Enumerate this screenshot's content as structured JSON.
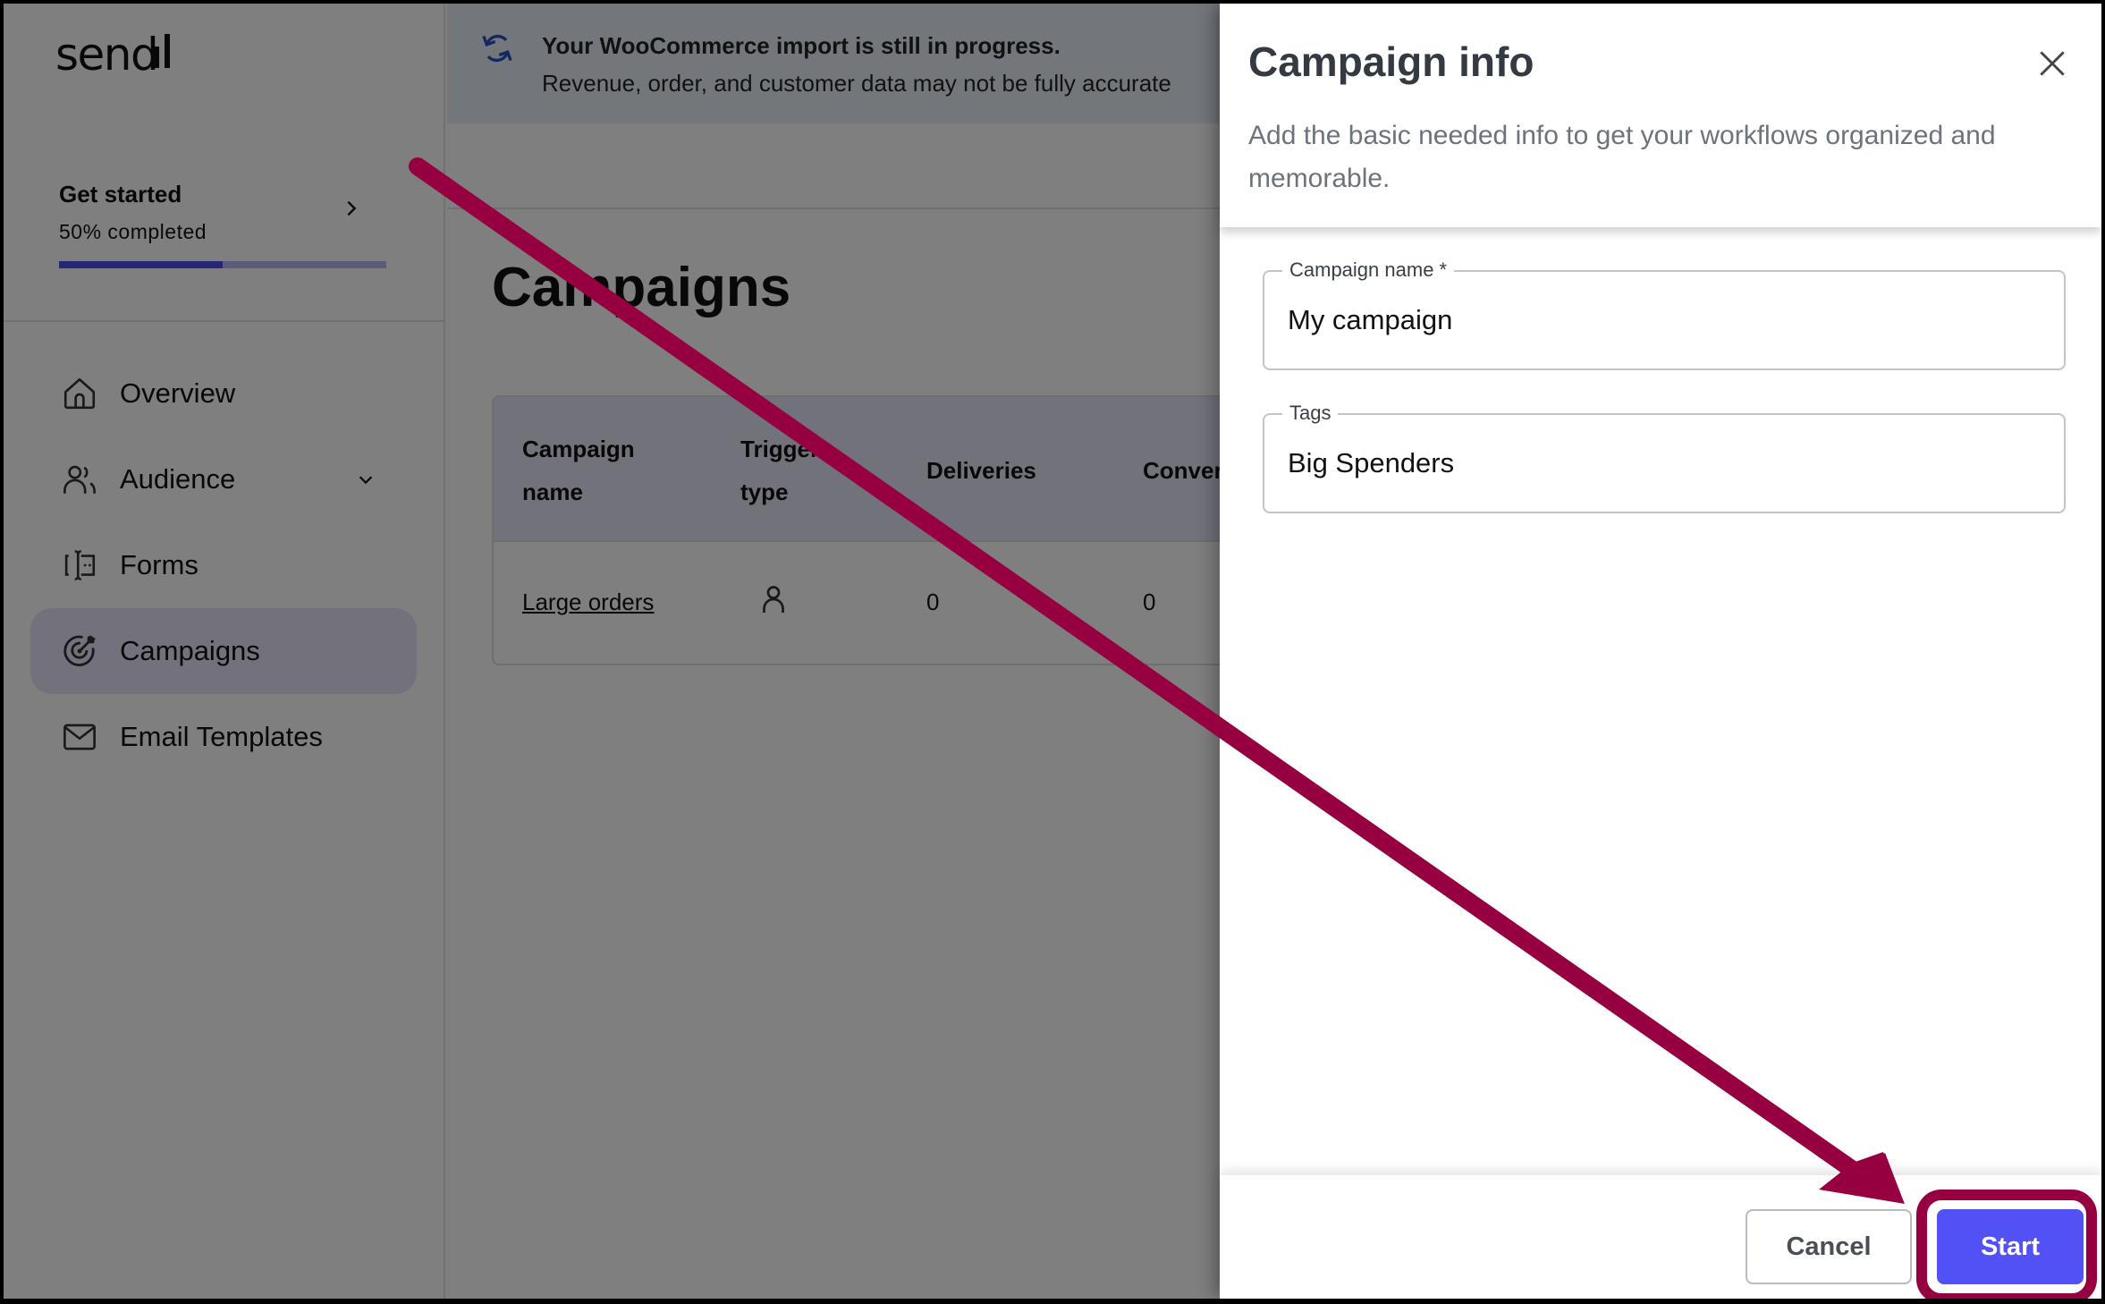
{
  "app": {
    "logo_text": "send",
    "brand_color": "#5151f5"
  },
  "sidebar": {
    "get_started": {
      "title": "Get started",
      "progress_label": "50% completed",
      "progress_fraction": 0.5
    },
    "items": [
      {
        "label": "Overview",
        "icon": "home-icon",
        "active": false
      },
      {
        "label": "Audience",
        "icon": "people-icon",
        "active": false,
        "has_submenu": true
      },
      {
        "label": "Forms",
        "icon": "form-icon",
        "active": false
      },
      {
        "label": "Campaigns",
        "icon": "target-icon",
        "active": true
      },
      {
        "label": "Email Templates",
        "icon": "mail-icon",
        "active": false
      }
    ]
  },
  "banner": {
    "icon": "sync-icon",
    "title": "Your WooCommerce import is still in progress.",
    "subtitle": "Revenue, order, and customer data may not be fully accurate"
  },
  "main": {
    "page_title": "Campaigns",
    "table": {
      "columns": [
        "Campaign name",
        "Trigger type",
        "Deliveries",
        "Conver"
      ],
      "column_lines": [
        [
          "Campaign",
          "name"
        ],
        [
          "Trigger",
          "type"
        ],
        [
          "Deliveries"
        ],
        [
          "Conver"
        ]
      ],
      "rows": [
        {
          "name": "Large orders",
          "trigger_icon": "person-icon",
          "deliveries": "0",
          "conversions": "0"
        }
      ]
    }
  },
  "drawer": {
    "title": "Campaign info",
    "description": "Add the basic needed info to get your workflows organized and memorable.",
    "fields": {
      "campaign_name": {
        "label": "Campaign name *",
        "value": "My campaign",
        "required": true
      },
      "tags": {
        "label": "Tags",
        "value": "Big Spenders"
      }
    },
    "buttons": {
      "cancel": "Cancel",
      "start": "Start"
    }
  },
  "annotation": {
    "type": "arrow-to-highlight",
    "target": "start-button",
    "color": "#960041"
  }
}
